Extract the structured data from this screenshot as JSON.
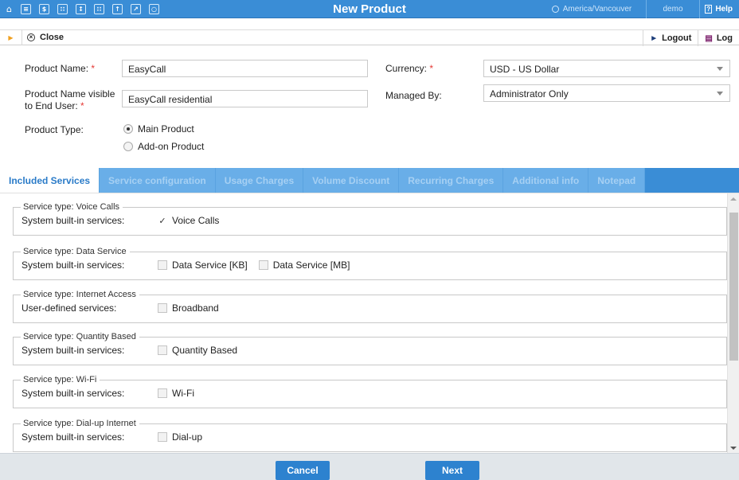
{
  "topbar": {
    "icons": [
      "home-icon",
      "list-icon",
      "dollar-icon",
      "grid-icon",
      "phone-icon",
      "numbers-icon",
      "upload-icon",
      "chart-icon",
      "search-icon"
    ],
    "title": "New Product",
    "timezone": "America/Vancouver",
    "user": "demo",
    "help": "Help",
    "color": "#3a8dd6"
  },
  "toolbar": {
    "close_label": "Close",
    "logout_label": "Logout",
    "log_label": "Log"
  },
  "form": {
    "product_name_label": "Product Name:",
    "product_name_value": "EasyCall",
    "product_name_visible_label_1": "Product Name visible",
    "product_name_visible_label_2": "to End User:",
    "product_name_visible_value": "EasyCall residential",
    "product_type_label": "Product Type:",
    "product_type_options": [
      "Main Product",
      "Add-on Product"
    ],
    "product_type_selected": "Main Product",
    "currency_label": "Currency:",
    "currency_value": "USD - US Dollar",
    "managed_by_label": "Managed By:",
    "managed_by_value": "Administrator Only",
    "required_mark": "*"
  },
  "tabs": [
    "Included Services",
    "Service configuration",
    "Usage Charges",
    "Volume Discount",
    "Recurring Charges",
    "Additional info",
    "Notepad"
  ],
  "active_tab": "Included Services",
  "services": [
    {
      "legend": "Service type: Voice Calls",
      "row_label": "System built-in services:",
      "items": [
        {
          "label": "Voice Calls",
          "checked": true
        }
      ]
    },
    {
      "legend": "Service type: Data Service",
      "row_label": "System built-in services:",
      "items": [
        {
          "label": "Data Service [KB]",
          "checked": false
        },
        {
          "label": "Data Service [MB]",
          "checked": false
        }
      ]
    },
    {
      "legend": "Service type: Internet Access",
      "row_label": "User-defined services:",
      "items": [
        {
          "label": "Broadband",
          "checked": false
        }
      ]
    },
    {
      "legend": "Service type: Quantity Based",
      "row_label": "System built-in services:",
      "items": [
        {
          "label": "Quantity Based",
          "checked": false
        }
      ]
    },
    {
      "legend": "Service type: Wi-Fi",
      "row_label": "System built-in services:",
      "items": [
        {
          "label": "Wi-Fi",
          "checked": false
        }
      ]
    },
    {
      "legend": "Service type: Dial-up Internet",
      "row_label": "System built-in services:",
      "items": [
        {
          "label": "Dial-up",
          "checked": false
        }
      ]
    }
  ],
  "footer": {
    "cancel_label": "Cancel",
    "next_label": "Next"
  }
}
